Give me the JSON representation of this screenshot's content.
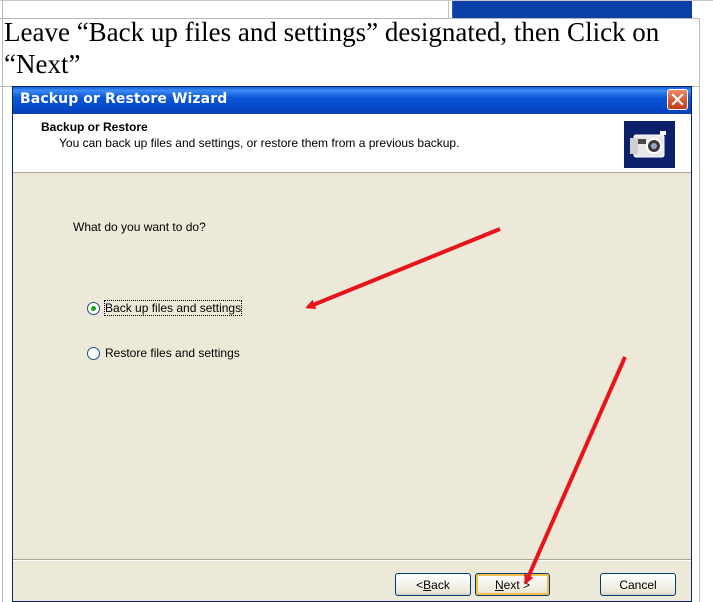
{
  "instruction": {
    "text": "Leave “Back up files and settings” designated, then Click on “Next”"
  },
  "dialog": {
    "title": "Backup or Restore Wizard",
    "header_title": "Backup or Restore",
    "header_subtitle": "You can back up files and settings, or restore them from a previous backup.",
    "header_icon": "backup-camera-icon",
    "question": "What do you want to do?",
    "options": [
      {
        "prefix": "",
        "accel": "B",
        "rest": "ack up files and settings",
        "selected": true
      },
      {
        "prefix": "",
        "accel": "R",
        "rest": "estore files and settings",
        "selected": false
      }
    ],
    "buttons": {
      "back": {
        "prefix": "< ",
        "accel": "B",
        "rest": "ack"
      },
      "next": {
        "prefix": "",
        "accel": "N",
        "rest": "ext >"
      },
      "cancel": {
        "label": "Cancel"
      }
    }
  },
  "colors": {
    "titlebar": "#0a58d6",
    "dialog_bg": "#ece9d8",
    "arrow": "#e8141b",
    "radio_selected": "#21a121"
  }
}
